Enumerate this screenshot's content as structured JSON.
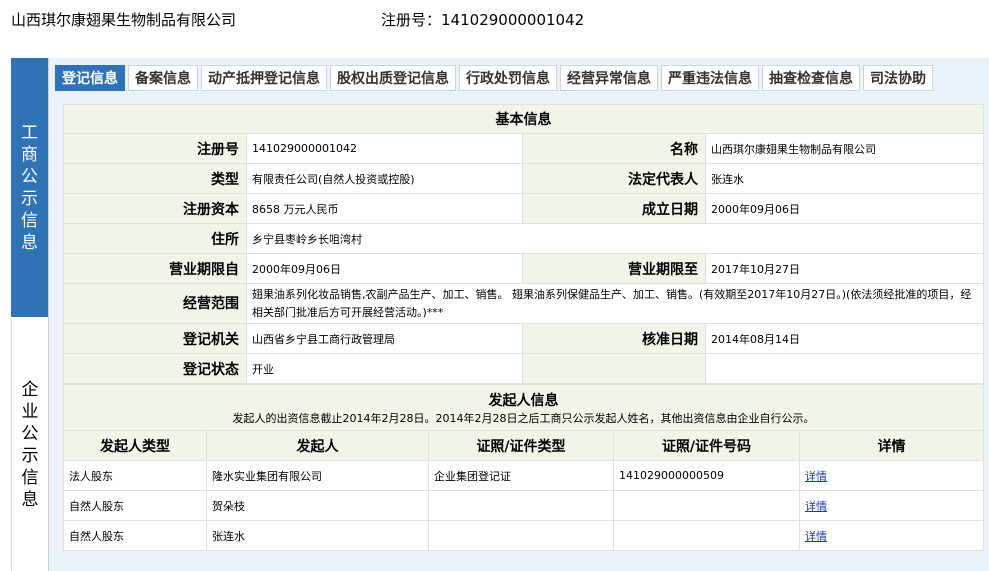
{
  "header": {
    "company_name": "山西琪尔康翅果生物制品有限公司",
    "reg_label": "注册号：",
    "reg_number": "141029000001042"
  },
  "sidebar": {
    "items": [
      {
        "label": "工商公示信息",
        "chars": [
          "工",
          "商",
          "公",
          "示",
          "信",
          "息"
        ],
        "active": true
      },
      {
        "label": "企业公示信息",
        "chars": [
          "企",
          "业",
          "公",
          "示",
          "信",
          "息"
        ],
        "active": false
      }
    ]
  },
  "tabs": [
    {
      "label": "登记信息",
      "active": true
    },
    {
      "label": "备案信息",
      "active": false
    },
    {
      "label": "动产抵押登记信息",
      "active": false
    },
    {
      "label": "股权出质登记信息",
      "active": false
    },
    {
      "label": "行政处罚信息",
      "active": false
    },
    {
      "label": "经营异常信息",
      "active": false
    },
    {
      "label": "严重违法信息",
      "active": false
    },
    {
      "label": "抽查检查信息",
      "active": false
    },
    {
      "label": "司法协助",
      "active": false
    }
  ],
  "basic": {
    "title": "基本信息",
    "reg_no_label": "注册号",
    "reg_no": "141029000001042",
    "name_label": "名称",
    "name": "山西琪尔康翅果生物制品有限公司",
    "type_label": "类型",
    "type": "有限责任公司(自然人投资或控股)",
    "legal_rep_label": "法定代表人",
    "legal_rep": "张连水",
    "capital_label": "注册资本",
    "capital": "8658 万元人民币",
    "established_label": "成立日期",
    "established": "2000年09月06日",
    "address_label": "住所",
    "address": "乡宁县枣岭乡长咀湾村",
    "term_from_label": "营业期限自",
    "term_from": "2000年09月06日",
    "term_to_label": "营业期限至",
    "term_to": "2017年10月27日",
    "scope_label": "经营范围",
    "scope": "翅果油系列化妆品销售,农副产品生产、加工、销售。 翅果油系列保健品生产、加工、销售。(有效期至2017年10月27日。)(依法须经批准的项目，经相关部门批准后方可开展经营活动。)***",
    "authority_label": "登记机关",
    "authority": "山西省乡宁县工商行政管理局",
    "approval_label": "核准日期",
    "approval": "2014年08月14日",
    "status_label": "登记状态",
    "status": "开业"
  },
  "sponsors": {
    "title": "发起人信息",
    "note": "发起人的出资信息截止2014年2月28日。2014年2月28日之后工商只公示发起人姓名，其他出资信息由企业自行公示。",
    "headers": [
      "发起人类型",
      "发起人",
      "证照/证件类型",
      "证照/证件号码",
      "详情"
    ],
    "rows": [
      {
        "type": "法人股东",
        "name": "隆水实业集团有限公司",
        "cert_type": "企业集团登记证",
        "cert_no": "141029000000509",
        "detail": "详情"
      },
      {
        "type": "自然人股东",
        "name": "贺朵枝",
        "cert_type": "",
        "cert_no": "",
        "detail": "详情"
      },
      {
        "type": "自然人股东",
        "name": "张连水",
        "cert_type": "",
        "cert_no": "",
        "detail": "详情"
      }
    ]
  }
}
